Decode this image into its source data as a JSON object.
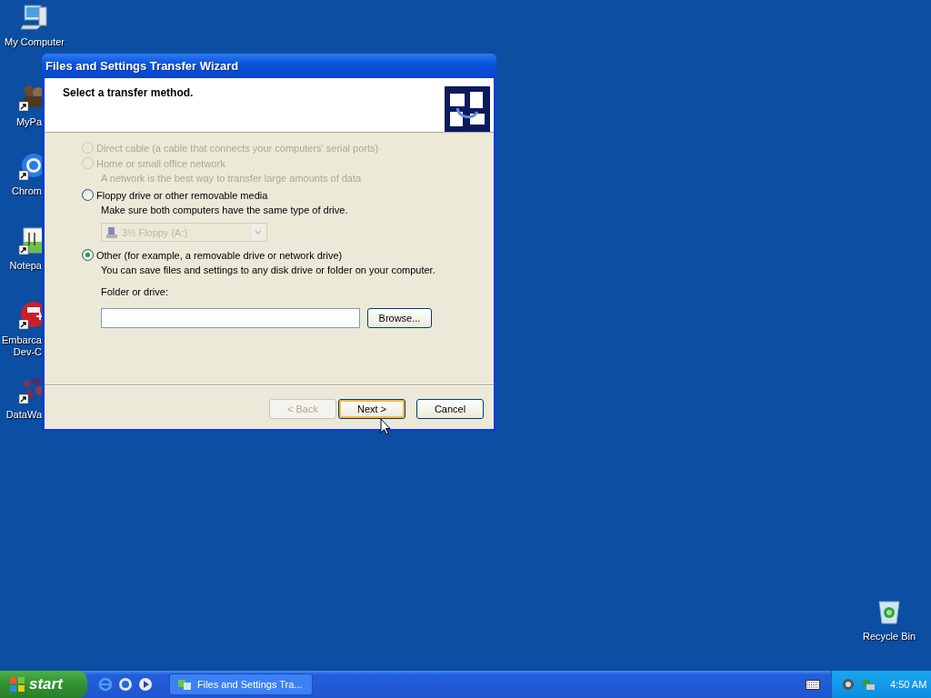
{
  "desktop_icons": [
    {
      "label": "My Computer",
      "kind": "computer",
      "shortcut": false
    },
    {
      "label": "MyPa",
      "kind": "people",
      "shortcut": true
    },
    {
      "label": "Chrom",
      "kind": "ring",
      "shortcut": true
    },
    {
      "label": "Notepa",
      "kind": "notepad",
      "shortcut": true
    },
    {
      "label": "Embarca\nDev-C",
      "kind": "dev",
      "shortcut": true
    },
    {
      "label": "DataWa",
      "kind": "dots",
      "shortcut": true
    },
    {
      "label": "Recycle Bin",
      "kind": "bin",
      "shortcut": false
    }
  ],
  "window": {
    "title": "Files and Settings Transfer Wizard",
    "heading": "Select a transfer method.",
    "options": [
      {
        "label": "Direct cable (a cable that connects your computers' serial ports)",
        "selected": false,
        "disabled": true
      },
      {
        "label": "Home or small office network",
        "selected": false,
        "disabled": true,
        "description": "A network is the best way to transfer large amounts of data"
      },
      {
        "label": "Floppy drive or other removable media",
        "selected": false,
        "disabled": false,
        "description": "Make sure both computers have the same type of drive.",
        "dropdown": {
          "value": "3½ Floppy (A:)",
          "disabled": true
        }
      },
      {
        "label": "Other (for example, a removable drive or network drive)",
        "selected": true,
        "disabled": false,
        "description": "You can save files and settings to any disk drive or folder on your computer.",
        "folder": {
          "label": "Folder or drive:",
          "button": "Browse..."
        }
      }
    ],
    "buttons": [
      {
        "label": "< Back",
        "disabled": true,
        "default": false
      },
      {
        "label": "Next >",
        "disabled": false,
        "default": true
      },
      {
        "label": "Cancel",
        "disabled": false,
        "default": false
      }
    ]
  },
  "taskbar": {
    "start": "start",
    "task": "Files and Settings Tra...",
    "clock": "4:50 AM"
  }
}
